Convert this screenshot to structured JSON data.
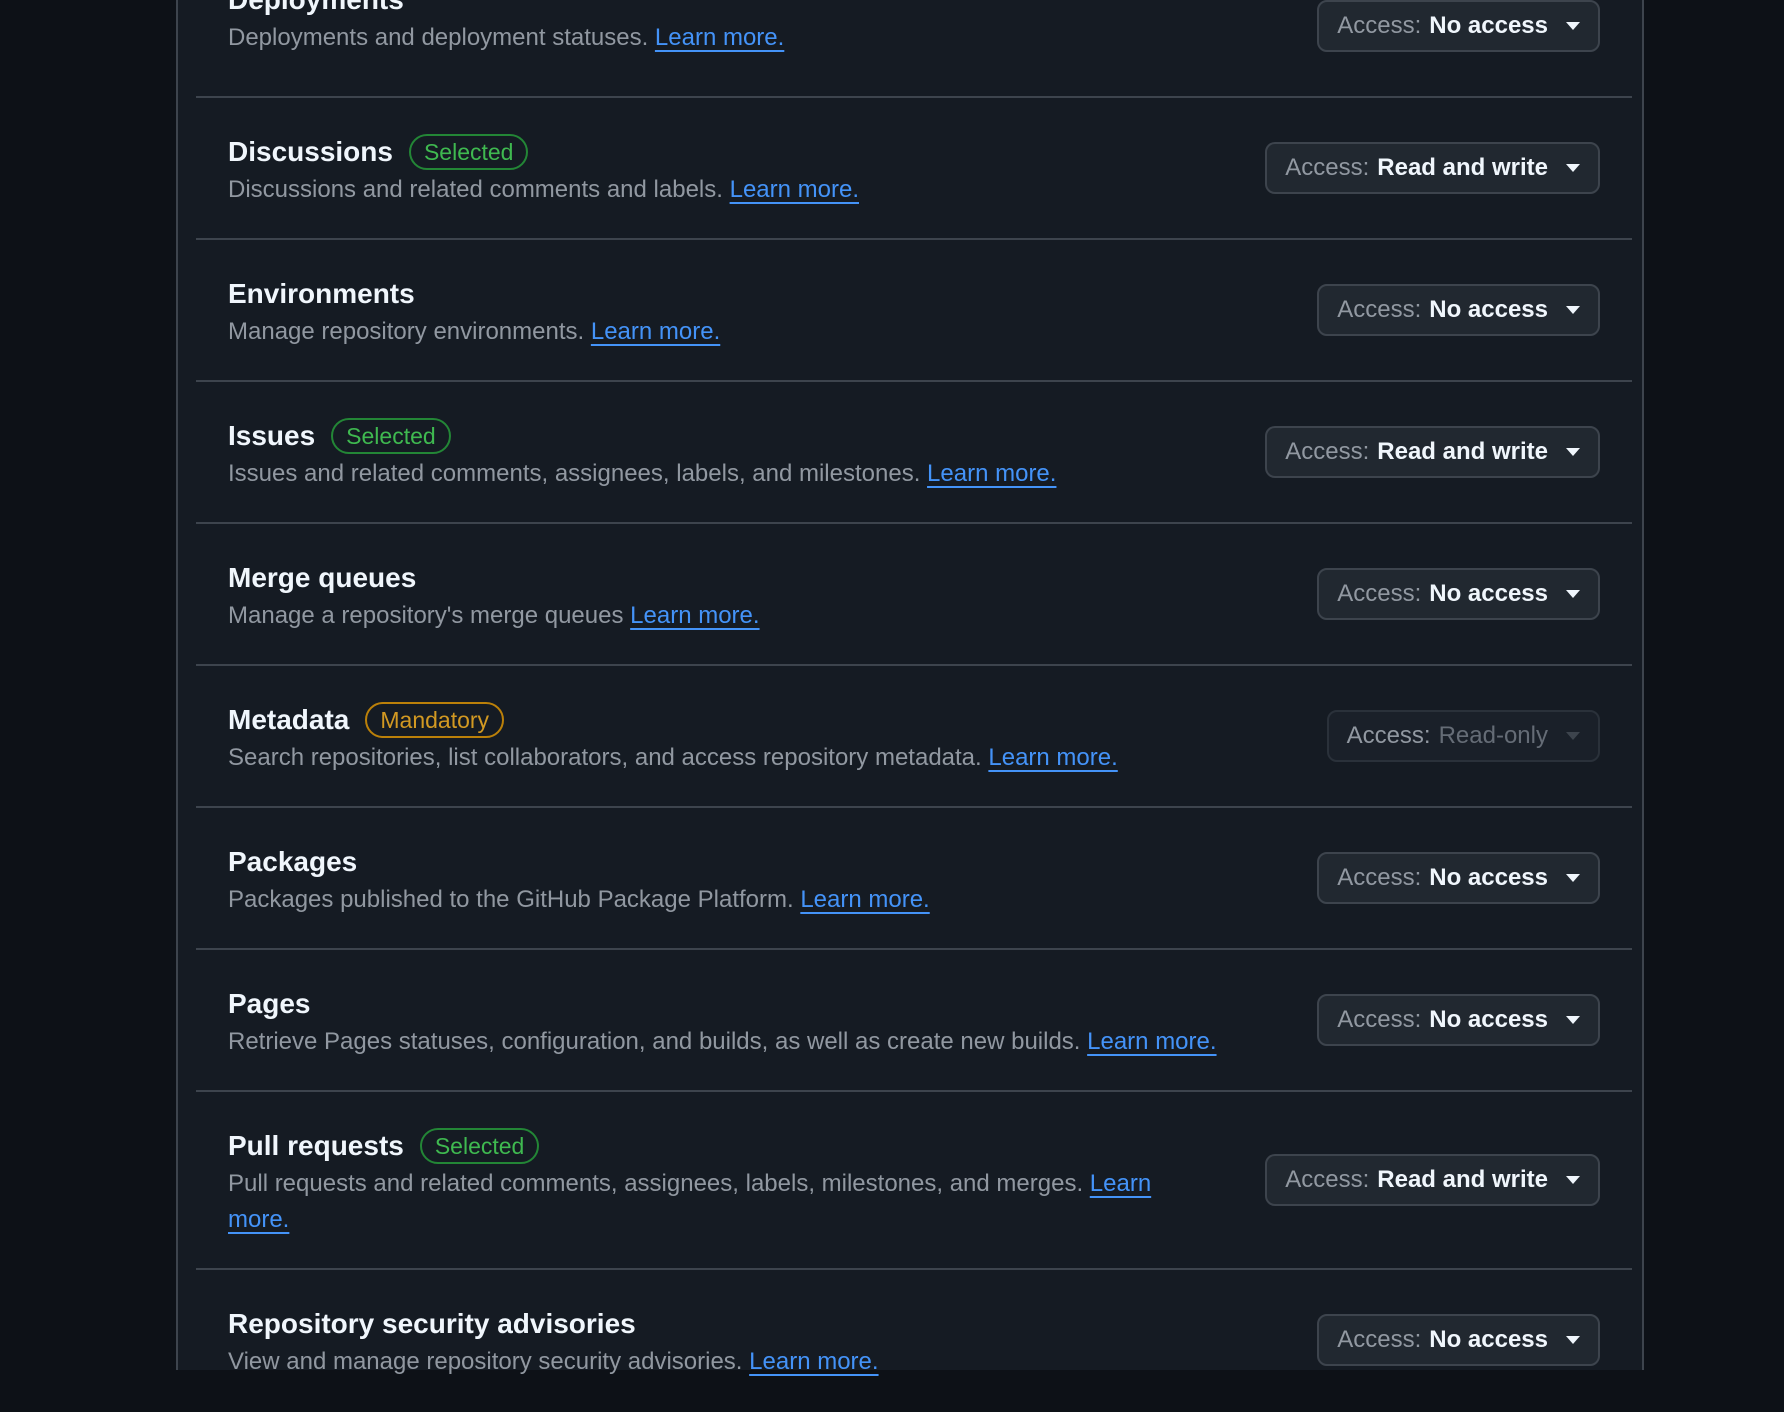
{
  "access_label": "Access:",
  "permissions": [
    {
      "title": "Deployments",
      "badge": "",
      "desc": "Deployments and deployment statuses.",
      "link": "Learn more.",
      "access": "No access",
      "disabled": false
    },
    {
      "title": "Discussions",
      "badge": "Selected",
      "desc": "Discussions and related comments and labels.",
      "link": "Learn more.",
      "access": "Read and write",
      "disabled": false
    },
    {
      "title": "Environments",
      "badge": "",
      "desc": "Manage repository environments.",
      "link": "Learn more.",
      "access": "No access",
      "disabled": false
    },
    {
      "title": "Issues",
      "badge": "Selected",
      "desc": "Issues and related comments, assignees, labels, and milestones.",
      "link": "Learn more.",
      "access": "Read and write",
      "disabled": false
    },
    {
      "title": "Merge queues",
      "badge": "",
      "desc": "Manage a repository's merge queues",
      "link": "Learn more.",
      "access": "No access",
      "disabled": false
    },
    {
      "title": "Metadata",
      "badge": "Mandatory",
      "desc": "Search repositories, list collaborators, and access repository metadata.",
      "link": "Learn more.",
      "access": "Read-only",
      "disabled": true
    },
    {
      "title": "Packages",
      "badge": "",
      "desc": "Packages published to the GitHub Package Platform.",
      "link": "Learn more.",
      "access": "No access",
      "disabled": false
    },
    {
      "title": "Pages",
      "badge": "",
      "desc": "Retrieve Pages statuses, configuration, and builds, as well as create new builds.",
      "link": "Learn more.",
      "access": "No access",
      "disabled": false
    },
    {
      "title": "Pull requests",
      "badge": "Selected",
      "desc": "Pull requests and related comments, assignees, labels, milestones, and merges.",
      "link": "Learn more.",
      "access": "Read and write",
      "disabled": false
    },
    {
      "title": "Repository security advisories",
      "badge": "",
      "desc": "View and manage repository security advisories.",
      "link": "Learn more.",
      "access": "No access",
      "disabled": false
    }
  ]
}
